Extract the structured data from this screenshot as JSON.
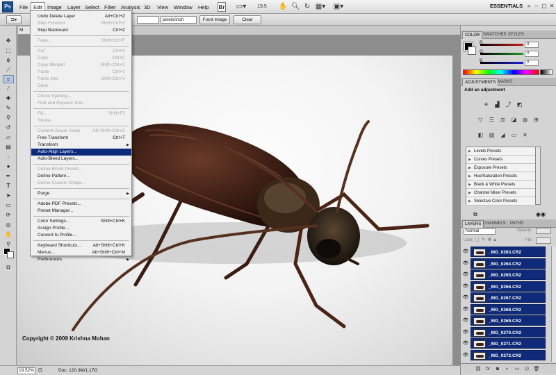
{
  "app": {
    "logo": "Ps"
  },
  "menubar": {
    "items": [
      "File",
      "Edit",
      "Image",
      "Layer",
      "Select",
      "Filter",
      "Analysis",
      "3D",
      "View",
      "Window",
      "Help"
    ],
    "zoom": "19.5",
    "workspace": "ESSENTIALS",
    "icons": [
      "bridge-icon",
      "mini-bridge-icon",
      "screen-mode-icon",
      "hand-icon",
      "zoom-icon",
      "rotate-icon",
      "arrange-icon",
      "screen-mode-icon"
    ]
  },
  "options": {
    "unit": "pixels/inch",
    "front_image": "Front Image",
    "clear": "Clear"
  },
  "document": {
    "tab_title": "M",
    "copyright": "Copyright © 2009 Krishna Mohan"
  },
  "status": {
    "zoom": "19.52%",
    "doc": "Doc: 120.3M/1.17G"
  },
  "edit_menu": [
    {
      "label": "Undo Delete Layer",
      "shortcut": "Alt+Ctrl+Z",
      "disabled": false
    },
    {
      "label": "Step Forward",
      "shortcut": "Shift+Ctrl+Z",
      "disabled": true
    },
    {
      "label": "Step Backward",
      "shortcut": "Ctrl+Z",
      "disabled": false
    },
    {
      "label": "Fade...",
      "shortcut": "Shift+Ctrl+F",
      "disabled": true
    },
    {
      "label": "Cut",
      "shortcut": "Ctrl+X",
      "disabled": true
    },
    {
      "label": "Copy",
      "shortcut": "Ctrl+C",
      "disabled": true
    },
    {
      "label": "Copy Merged",
      "shortcut": "Shift+Ctrl+C",
      "disabled": true
    },
    {
      "label": "Paste",
      "shortcut": "Ctrl+V",
      "disabled": true
    },
    {
      "label": "Paste Into",
      "shortcut": "Shift+Ctrl+V",
      "disabled": true
    },
    {
      "label": "Clear",
      "shortcut": "",
      "disabled": true
    },
    {
      "label": "Check Spelling...",
      "shortcut": "",
      "disabled": true
    },
    {
      "label": "Find and Replace Text...",
      "shortcut": "",
      "disabled": true
    },
    {
      "label": "Fill...",
      "shortcut": "Shift+F5",
      "disabled": true
    },
    {
      "label": "Stroke...",
      "shortcut": "",
      "disabled": true
    },
    {
      "label": "Content-Aware Scale",
      "shortcut": "Alt+Shift+Ctrl+C",
      "disabled": true
    },
    {
      "label": "Free Transform",
      "shortcut": "Ctrl+T",
      "disabled": false
    },
    {
      "label": "Transform",
      "shortcut": "",
      "disabled": false,
      "submenu": true
    },
    {
      "label": "Auto-Align Layers...",
      "shortcut": "",
      "disabled": false,
      "highlighted": true
    },
    {
      "label": "Auto-Blend Layers...",
      "shortcut": "",
      "disabled": false
    },
    {
      "label": "Define Brush Preset...",
      "shortcut": "",
      "disabled": true
    },
    {
      "label": "Define Pattern...",
      "shortcut": "",
      "disabled": false
    },
    {
      "label": "Define Custom Shape...",
      "shortcut": "",
      "disabled": true
    },
    {
      "label": "Purge",
      "shortcut": "",
      "disabled": false,
      "submenu": true
    },
    {
      "label": "Adobe PDF Presets...",
      "shortcut": "",
      "disabled": false
    },
    {
      "label": "Preset Manager...",
      "shortcut": "",
      "disabled": false
    },
    {
      "label": "Color Settings...",
      "shortcut": "Shift+Ctrl+K",
      "disabled": false
    },
    {
      "label": "Assign Profile...",
      "shortcut": "",
      "disabled": false
    },
    {
      "label": "Convert to Profile...",
      "shortcut": "",
      "disabled": false
    },
    {
      "label": "Keyboard Shortcuts...",
      "shortcut": "Alt+Shift+Ctrl+K",
      "disabled": false
    },
    {
      "label": "Menus...",
      "shortcut": "Alt+Shift+Ctrl+M",
      "disabled": false
    },
    {
      "label": "Preferences",
      "shortcut": "",
      "disabled": false,
      "submenu": true
    }
  ],
  "color_panel": {
    "tabs": [
      "COLOR",
      "SWATCHES",
      "STYLES"
    ],
    "channels": [
      {
        "label": "R",
        "value": "0",
        "color": "#d21f1f"
      },
      {
        "label": "G",
        "value": "0",
        "color": "#1f9a1f"
      },
      {
        "label": "B",
        "value": "0",
        "color": "#1f1fd2"
      }
    ]
  },
  "adjustments_panel": {
    "tabs": [
      "ADJUSTMENTS",
      "MASKS"
    ],
    "heading": "Add an adjustment",
    "presets": [
      "Levels Presets",
      "Curves Presets",
      "Exposure Presets",
      "Hue/Saturation Presets",
      "Black & White Presets",
      "Channel Mixer Presets",
      "Selective Color Presets"
    ]
  },
  "layers_panel": {
    "tabs": [
      "LAYERS",
      "CHANNELS",
      "PATHS"
    ],
    "blend_mode": "Normal",
    "opacity_label": "Opacity:",
    "lock_label": "Lock:",
    "fill_label": "Fill:",
    "layers": [
      "_MG_0263.CR2",
      "_MG_0264.CR2",
      "_MG_0265.CR2",
      "_MG_0266.CR2",
      "_MG_0267.CR2",
      "_MG_0268.CR2",
      "_MG_0269.CR2",
      "_MG_0270.CR2",
      "_MG_0271.CR2",
      "_MG_0272.CR2"
    ]
  },
  "colors": {
    "accent": "#0b2a7c",
    "layer_selected": "#0e2a78"
  }
}
